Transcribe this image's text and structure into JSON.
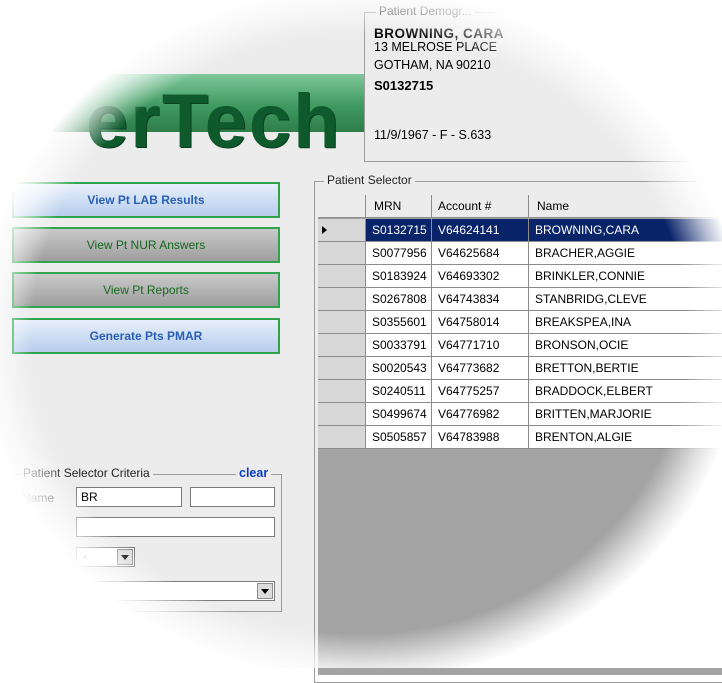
{
  "logo": {
    "text": "erTech"
  },
  "demographics": {
    "legend": "Patient Demogr...",
    "name": "BROWNING, CARA",
    "address1": "13 MELROSE PLACE",
    "address2": "GOTHAM, NA 90210",
    "mrn": "S0132715",
    "summary": "11/9/1967  -  F  -  S.633"
  },
  "buttons": {
    "lab": "View Pt LAB Results",
    "nur": "View Pt NUR Answers",
    "reports": "View Pt Reports",
    "pmar": "Generate Pts PMAR"
  },
  "selector": {
    "legend": "Patient Selector",
    "columns": [
      "MRN",
      "Account #",
      "Name"
    ],
    "rows": [
      [
        "S0132715",
        "V64624141",
        "BROWNING,CARA"
      ],
      [
        "S0077956",
        "V64625684",
        "BRACHER,AGGIE"
      ],
      [
        "S0183924",
        "V64693302",
        "BRINKLER,CONNIE"
      ],
      [
        "S0267808",
        "V64743834",
        "STANBRIDG,CLEVE"
      ],
      [
        "S0355601",
        "V64758014",
        "BREAKSPEA,INA"
      ],
      [
        "S0033791",
        "V64771710",
        "BRONSON,OCIE"
      ],
      [
        "S0020543",
        "V64773682",
        "BRETTON,BERTIE"
      ],
      [
        "S0240511",
        "V64775257",
        "BRADDOCK,ELBERT"
      ],
      [
        "S0499674",
        "V64776982",
        "BRITTEN,MARJORIE"
      ],
      [
        "S0505857",
        "V64783988",
        "BRENTON,ALGIE"
      ]
    ],
    "selected_index": 0
  },
  "criteria": {
    "legend": "Patient Selector Criteria",
    "clear_label": "clear",
    "name_label": "Name",
    "name_value": "BR",
    "first_name_value": "",
    "other_value": "",
    "small_select_value": "-",
    "wide_select_value": ""
  },
  "colors": {
    "brand_green": "#2f7e4a",
    "button_border": "#2ea54a",
    "selection": "#0a246a",
    "link": "#0b3cc7"
  }
}
